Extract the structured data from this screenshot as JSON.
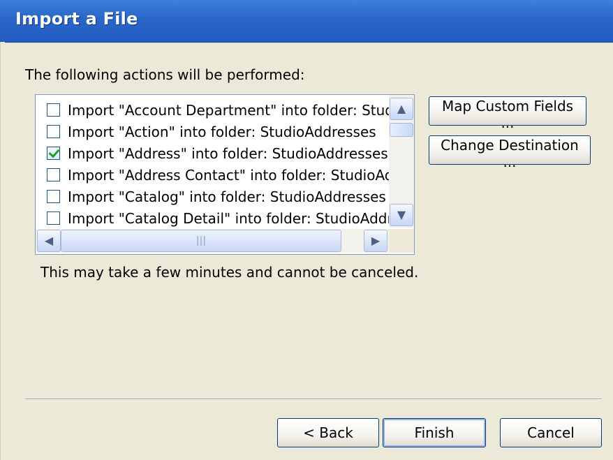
{
  "window": {
    "title": "Import a File"
  },
  "actions_label": "The following actions will be performed:",
  "actions": [
    {
      "label": "Import \"Account Department\" into folder: Studi...",
      "checked": false
    },
    {
      "label": "Import \"Action\" into folder: StudioAddresses",
      "checked": false
    },
    {
      "label": "Import \"Address\" into folder: StudioAddresses",
      "checked": true
    },
    {
      "label": "Import \"Address Contact\" into folder: StudioAd...",
      "checked": false
    },
    {
      "label": "Import \"Catalog\" into folder: StudioAddresses",
      "checked": false
    },
    {
      "label": "Import \"Catalog Detail\" into folder: StudioAddre...",
      "checked": false
    }
  ],
  "buttons": {
    "map_custom_fields": "Map Custom Fields ...",
    "change_destination": "Change Destination ...",
    "back": "< Back",
    "finish": "Finish",
    "cancel": "Cancel"
  },
  "note": "This may take a few minutes and cannot be canceled.",
  "scroll": {
    "up": "▲",
    "down": "▼",
    "left": "◀",
    "right": "▶",
    "grip": "|||"
  },
  "colors": {
    "title_bar": "#2a66c8",
    "dialog_bg": "#ece9d8",
    "check_mark": "#21a121"
  }
}
